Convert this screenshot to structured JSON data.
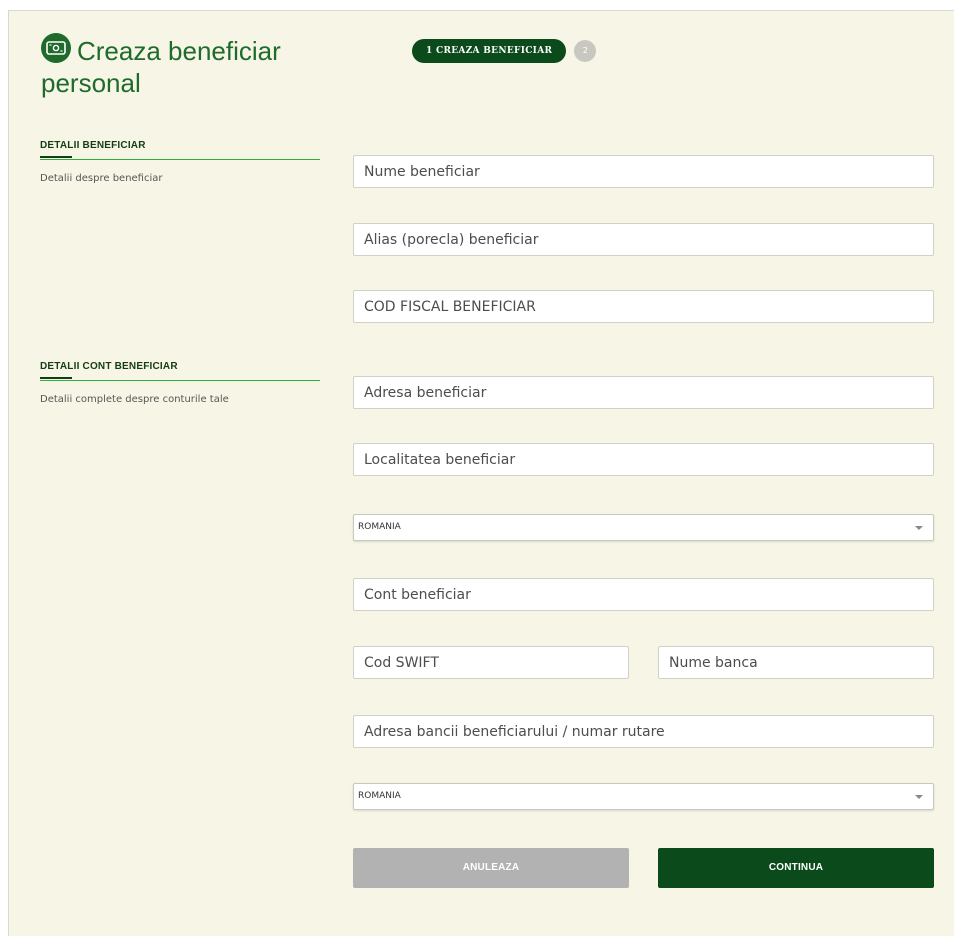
{
  "title": {
    "icon": "bill-icon",
    "text": "Creaza beneficiar personal"
  },
  "stepper": {
    "active_label": "1 CREAZA BENEFICIAR",
    "inactive_label": "2"
  },
  "sections": {
    "beneficiary": {
      "title": "DETALII BENEFICIAR",
      "description": "Detalii despre beneficiar"
    },
    "account": {
      "title": "DETALII CONT BENEFICIAR",
      "description": "Detalii complete despre conturile tale"
    }
  },
  "fields": {
    "name": {
      "placeholder": "Nume beneficiar",
      "value": ""
    },
    "alias": {
      "placeholder": "Alias (porecla) beneficiar",
      "value": ""
    },
    "fiscal_code": {
      "placeholder": "COD FISCAL BENEFICIAR",
      "value": ""
    },
    "address": {
      "placeholder": "Adresa beneficiar",
      "value": ""
    },
    "city": {
      "placeholder": "Localitatea beneficiar",
      "value": ""
    },
    "country": {
      "selected": "ROMANIA",
      "icon": "chevron-down-icon"
    },
    "account": {
      "placeholder": "Cont beneficiar",
      "value": ""
    },
    "swift": {
      "placeholder": "Cod SWIFT",
      "value": ""
    },
    "bank_name": {
      "placeholder": "Nume banca",
      "value": ""
    },
    "bank_address": {
      "placeholder": "Adresa bancii beneficiarului / numar rutare",
      "value": ""
    },
    "bank_country": {
      "selected": "ROMANIA",
      "icon": "chevron-down-icon"
    }
  },
  "buttons": {
    "cancel": "ANULEAZA",
    "continue": "CONTINUA"
  },
  "colors": {
    "panel_bg": "#f7f6e6",
    "brand_green": "#1e6b2c",
    "dark_green": "#0b4a1a",
    "accent_line": "#2fae3b",
    "disabled_gray": "#b2b2b2"
  }
}
